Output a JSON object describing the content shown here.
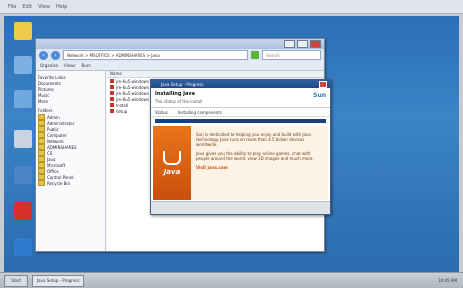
{
  "menubar": {
    "items": [
      "File",
      "Edit",
      "View",
      "Help"
    ]
  },
  "desktop_icons": [
    {
      "name": "folder-icon",
      "label": "",
      "color": "#f0c94a"
    },
    {
      "name": "computer-icon",
      "label": "",
      "color": "#7eb0e6"
    },
    {
      "name": "network-icon",
      "label": "",
      "color": "#6fa8dc"
    },
    {
      "name": "recycle-bin-icon",
      "label": "",
      "color": "#c9d4e0"
    },
    {
      "name": "document-icon",
      "label": "",
      "color": "#4a86c5"
    },
    {
      "name": "acrobat-icon",
      "label": "",
      "color": "#d6322a"
    },
    {
      "name": "ie-icon",
      "label": "",
      "color": "#2e7bd0"
    }
  ],
  "explorer": {
    "address": "Network > MSOFFICE > ADMINSHARES > Java",
    "search_placeholder": "Search",
    "toolbar": [
      "Organize",
      "Views",
      "Burn"
    ],
    "tree": {
      "favorites": [
        "Favorite Links",
        "Documents",
        "Pictures",
        "Music",
        "More"
      ],
      "folders_label": "Folders",
      "folders": [
        "Admin",
        "Administrator",
        "Public",
        "Computer",
        "Network",
        "ADMINSHARES",
        "CS",
        "Java",
        "Microsoft",
        "Office",
        "Control Panel",
        "Recycle Bin"
      ]
    },
    "filelist": {
      "header": "Name",
      "files": [
        "jre-6u5-windows",
        "jre-6u5-windows",
        "jre-6u5-windows",
        "jre-6u5-windows",
        "Install",
        "setup"
      ]
    }
  },
  "java": {
    "title": "Java Setup - Progress",
    "heading": "Installing Java",
    "subheading": "The status of the install",
    "logo": "Sun",
    "steps": [
      "Status",
      "Installing components"
    ],
    "body_1": "Sun is dedicated to helping you enjoy and build with Java technology. Java runs on more than 4.5 billion devices worldwide.",
    "body_2": "Java gives you the ability to play online games, chat with people around the world, view 3D images and much more.",
    "link": "Visit java.com",
    "brand": "Java"
  },
  "taskbar": {
    "start": "Start",
    "items": [
      "Java Setup - Progress"
    ],
    "clock": "10:45 AM"
  }
}
